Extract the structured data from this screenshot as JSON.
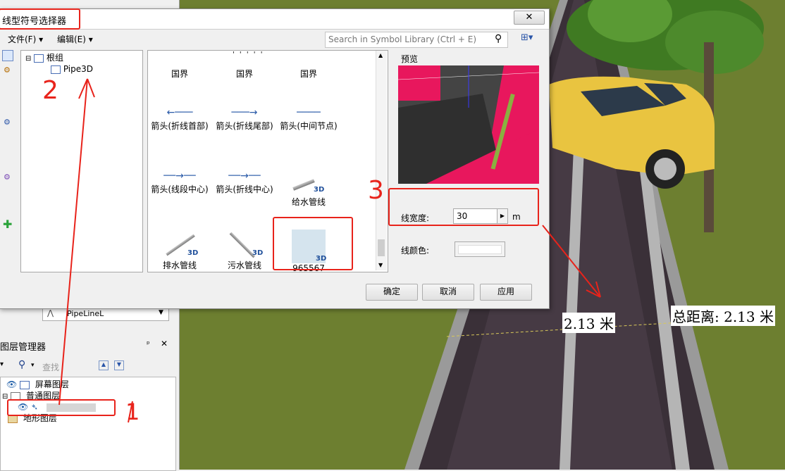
{
  "dialog": {
    "title": "线型符号选择器",
    "close": "✕",
    "menu": [
      "文件(F)",
      "编辑(E)"
    ],
    "search_placeholder": "Search in Symbol Library (Ctrl + E)",
    "tree": {
      "root": "根组",
      "child": "Pipe3D"
    },
    "top_dots": "' ' ' ' '",
    "symbols": [
      {
        "label": "国界"
      },
      {
        "label": "国界"
      },
      {
        "label": "国界"
      },
      {
        "label": "箭头(折线首部)"
      },
      {
        "label": "箭头(折线尾部)"
      },
      {
        "label": "箭头(中间节点)"
      },
      {
        "label": "箭头(线段中心)"
      },
      {
        "label": "箭头(折线中心)"
      },
      {
        "label": "给水管线",
        "badge": "3D"
      },
      {
        "label": "排水管线",
        "badge": "3D"
      },
      {
        "label": "污水管线",
        "badge": "3D"
      },
      {
        "label": "965567",
        "badge": "3D"
      }
    ],
    "preview_label": "预览",
    "width_label": "线宽度:",
    "width_value": "30",
    "width_unit": "m",
    "color_label": "线颜色:",
    "color_value": "#ffffff",
    "ok": "确定",
    "cancel": "取消",
    "apply": "应用"
  },
  "left_panel": {
    "combo_value": "PipeLineL",
    "layer_manager_title": "图层管理器",
    "pin": "ᵖ",
    "close": "✕",
    "search_placeholder": "查找",
    "layers": [
      "屏幕图层",
      "普通图层",
      "地形图层"
    ]
  },
  "scene": {
    "measure_label": "2.13 米",
    "total_label": "总距离: 2.13 米"
  },
  "annotations": [
    "2",
    "3",
    "1"
  ],
  "colors": {
    "accent_red": "#e8231b",
    "preview_magenta": "#e8175d",
    "car_yellow": "#e9c440"
  }
}
